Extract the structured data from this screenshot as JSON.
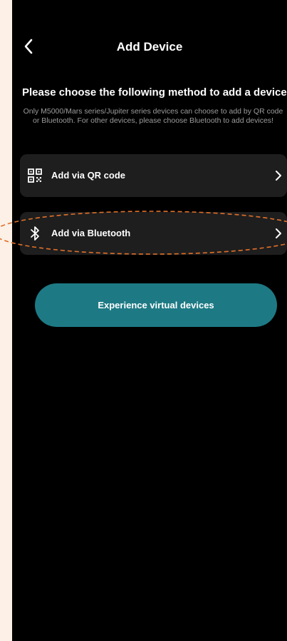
{
  "header": {
    "back_icon": "chevron-left-icon",
    "title": "Add Device"
  },
  "content": {
    "heading": "Please choose the following method to add a device",
    "description": "Only M5000/Mars series/Jupiter series devices can choose to add by QR code or Bluetooth. For other devices, please choose Bluetooth to add devices!"
  },
  "options": [
    {
      "label": "Add via QR code",
      "icon": "qr-code-icon",
      "chevron": "chevron-right-icon"
    },
    {
      "label": "Add via Bluetooth",
      "icon": "bluetooth-icon",
      "chevron": "chevron-right-icon"
    }
  ],
  "virtual_button": {
    "label": "Experience virtual devices"
  },
  "colors": {
    "background": "#000000",
    "card": "#1e1e1e",
    "accent": "#1d7a85",
    "highlight_annotation": "#e0702a",
    "outer_frame": "#fdf0e6"
  }
}
